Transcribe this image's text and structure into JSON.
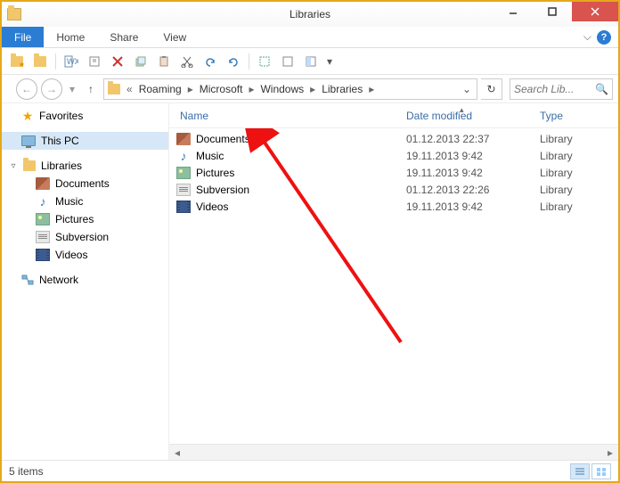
{
  "window": {
    "title": "Libraries"
  },
  "ribbon": {
    "file": "File",
    "tabs": [
      "Home",
      "Share",
      "View"
    ]
  },
  "breadcrumbs": {
    "prefix": "«",
    "parts": [
      "Roaming",
      "Microsoft",
      "Windows",
      "Libraries"
    ]
  },
  "search": {
    "placeholder": "Search Lib..."
  },
  "columns": {
    "name": "Name",
    "date": "Date modified",
    "type": "Type"
  },
  "sidebar": {
    "favorites": "Favorites",
    "thispc": "This PC",
    "libraries": "Libraries",
    "lib_items": [
      {
        "label": "Documents",
        "icon": "doc"
      },
      {
        "label": "Music",
        "icon": "music"
      },
      {
        "label": "Pictures",
        "icon": "pic"
      },
      {
        "label": "Subversion",
        "icon": "sub"
      },
      {
        "label": "Videos",
        "icon": "vid"
      }
    ],
    "network": "Network"
  },
  "files": [
    {
      "name": "Documents",
      "date": "01.12.2013 22:37",
      "type": "Library",
      "icon": "doc"
    },
    {
      "name": "Music",
      "date": "19.11.2013 9:42",
      "type": "Library",
      "icon": "music"
    },
    {
      "name": "Pictures",
      "date": "19.11.2013 9:42",
      "type": "Library",
      "icon": "pic"
    },
    {
      "name": "Subversion",
      "date": "01.12.2013 22:26",
      "type": "Library",
      "icon": "sub"
    },
    {
      "name": "Videos",
      "date": "19.11.2013 9:42",
      "type": "Library",
      "icon": "vid"
    }
  ],
  "status": {
    "text": "5 items"
  }
}
